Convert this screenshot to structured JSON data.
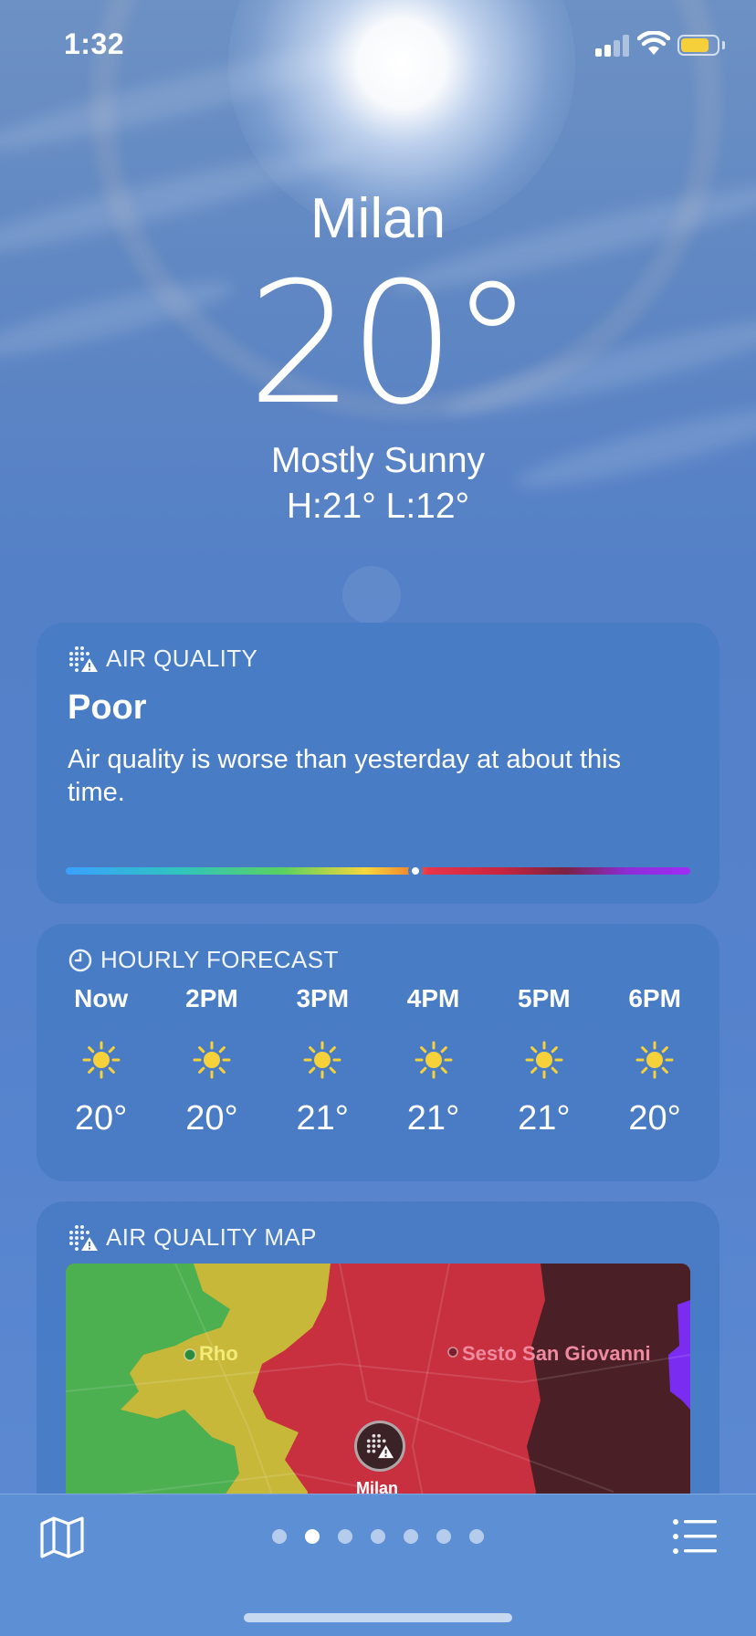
{
  "status_bar": {
    "time": "1:32",
    "battery_color": "#f5d03a",
    "battery_level": 0.8
  },
  "weather": {
    "city": "Milan",
    "temperature": "20°",
    "condition": "Mostly Sunny",
    "high_low": "H:21°  L:12°"
  },
  "air_quality": {
    "header": "AIR QUALITY",
    "level": "Poor",
    "description": "Air quality is worse than yesterday at about this time.",
    "scale_position": 0.56
  },
  "hourly": {
    "header": "HOURLY FORECAST",
    "hours": [
      {
        "label": "Now",
        "icon": "sun-icon",
        "temp": "20°"
      },
      {
        "label": "2PM",
        "icon": "sun-icon",
        "temp": "20°"
      },
      {
        "label": "3PM",
        "icon": "sun-icon",
        "temp": "21°"
      },
      {
        "label": "4PM",
        "icon": "sun-icon",
        "temp": "21°"
      },
      {
        "label": "5PM",
        "icon": "sun-icon",
        "temp": "21°"
      },
      {
        "label": "6PM",
        "icon": "sun-icon",
        "temp": "20°"
      }
    ]
  },
  "aq_map": {
    "header": "AIR QUALITY MAP",
    "labels": {
      "rho": "Rho",
      "sesto": "Sesto San Giovanni",
      "milan": "Milan"
    },
    "colors": {
      "good": "#4caf50",
      "moderate": "#c8b83a",
      "poor": "#c8303f",
      "very_poor": "#4a1f26",
      "extreme": "#7a2cf0"
    }
  },
  "bottom_bar": {
    "page_count": 7,
    "active_page": 1
  }
}
